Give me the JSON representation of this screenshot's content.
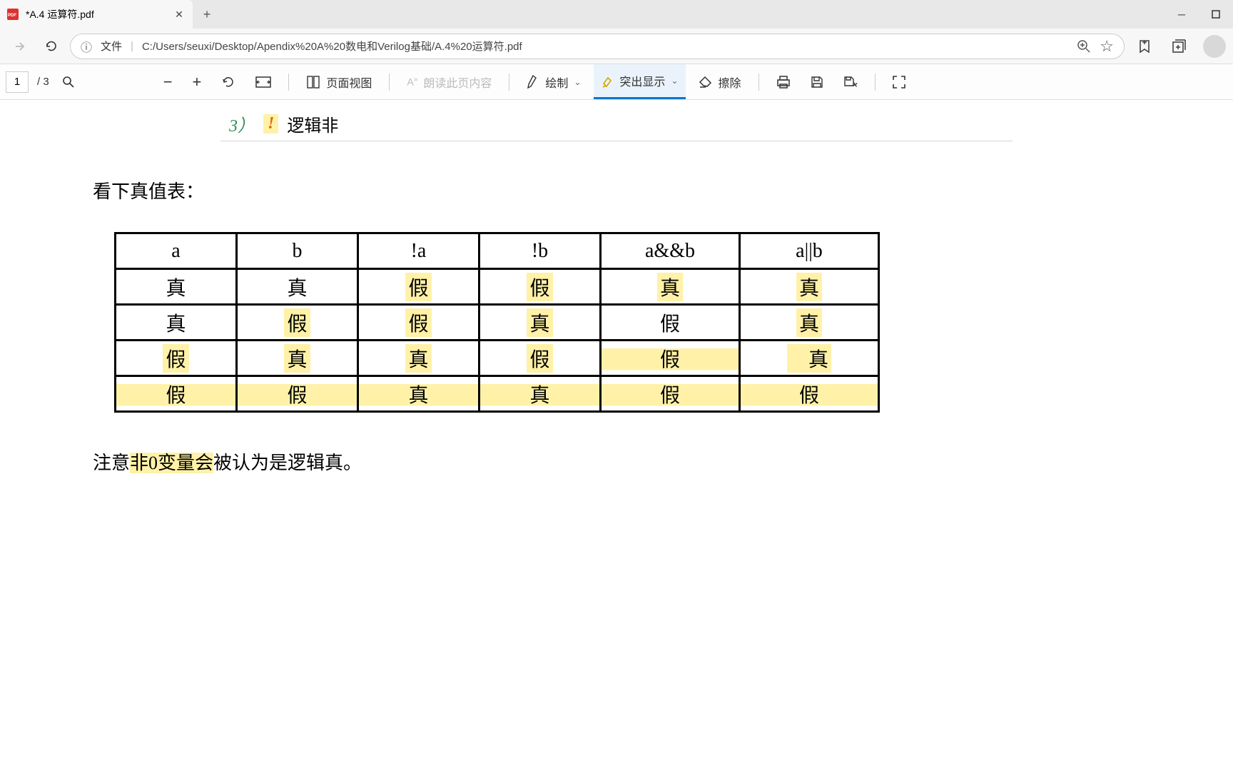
{
  "tab": {
    "title": "*A.4 运算符.pdf"
  },
  "addressbar": {
    "label": "文件",
    "path": "C:/Users/seuxi/Desktop/Apendix%20A%20数电和Verilog基础/A.4%20运算符.pdf"
  },
  "pdftoolbar": {
    "page": "1",
    "total": "/ 3",
    "pageView": "页面视图",
    "readAloud": "朗读此页内容",
    "draw": "绘制",
    "highlight": "突出显示",
    "erase": "擦除"
  },
  "doc": {
    "boxNum": "3）",
    "boxBang": "!",
    "boxLabel": "逻辑非",
    "heading": "看下真值表：",
    "table": {
      "headers": [
        "a",
        "b",
        "!a",
        "!b",
        "a&&b",
        "a||b"
      ],
      "rows": [
        [
          "真",
          "真",
          "假",
          "假",
          "真",
          "真"
        ],
        [
          "真",
          "假",
          "假",
          "真",
          "假",
          "真"
        ],
        [
          "假",
          "真",
          "真",
          "假",
          "假",
          "真"
        ],
        [
          "假",
          "假",
          "真",
          "真",
          "假",
          "假"
        ]
      ]
    },
    "note1": "注意",
    "note_hl": "非0变量会",
    "note2": "被认为是逻辑真。"
  }
}
